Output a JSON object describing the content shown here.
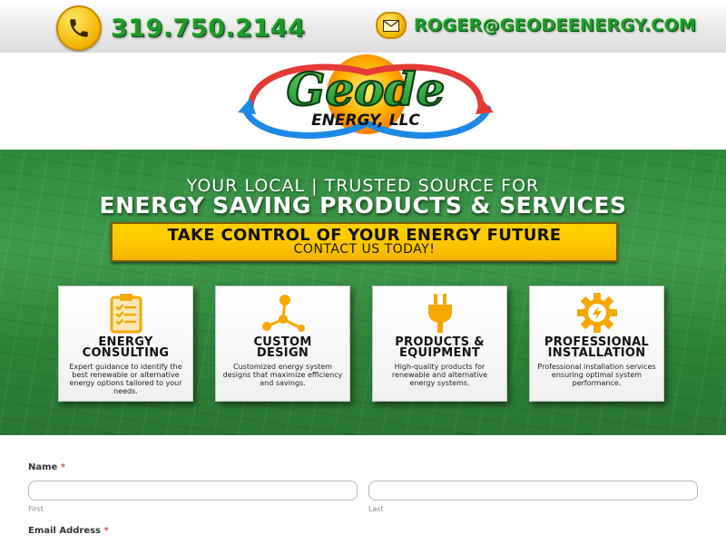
{
  "contact": {
    "phone": "319.750.2144",
    "email": "ROGER@GEODEENERGY.COM"
  },
  "logo": {
    "word": "Geode",
    "sub": "ENERGY, LLC"
  },
  "hero": {
    "line1": "YOUR LOCAL | TRUSTED SOURCE FOR",
    "line2": "ENERGY SAVING PRODUCTS & SERVICES",
    "cta_main": "TAKE CONTROL OF YOUR ENERGY FUTURE",
    "cta_sub": "CONTACT US TODAY!"
  },
  "services": [
    {
      "title_1": "ENERGY",
      "title_2": "CONSULTING",
      "desc": "Expert guidance to identify the best renewable or alternative energy options tailored to your needs.",
      "icon": "clipboard-checklist-icon"
    },
    {
      "title_1": "CUSTOM",
      "title_2": "DESIGN",
      "desc": "Customized energy system designs that maximize efficiency and savings.",
      "icon": "network-nodes-icon"
    },
    {
      "title_1": "PRODUCTS &",
      "title_2": "EQUIPMENT",
      "desc": "High-quality products for renewable and alternative energy systems.",
      "icon": "power-plug-icon"
    },
    {
      "title_1": "PROFESSIONAL",
      "title_2": "INSTALLATION",
      "desc": "Professional installation services ensuring optimal system performance.",
      "icon": "gear-bolt-icon"
    }
  ],
  "form": {
    "name_label": "Name",
    "required_mark": "*",
    "first_value": "",
    "last_value": "",
    "first_sub": "First",
    "last_sub": "Last",
    "email_label": "Email Address"
  },
  "colors": {
    "brand_green": "#1f9a2a",
    "brand_yellow": "#ffc800",
    "hero_green": "#2f8a3c",
    "required_red": "#d9534f"
  }
}
